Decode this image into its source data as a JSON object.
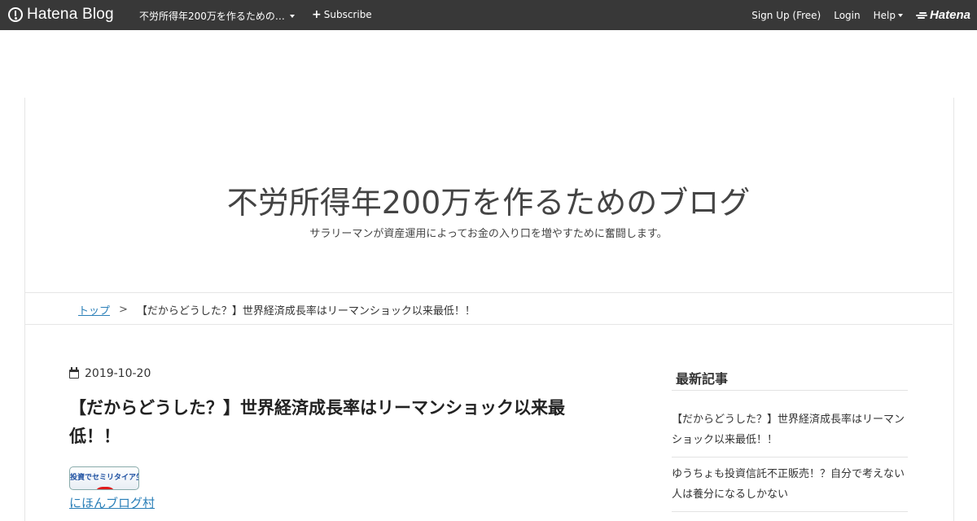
{
  "topbar": {
    "logo_text": "Hatena Blog",
    "blog_selector": "不労所得年200万を作るための…",
    "subscribe": "Subscribe",
    "sign_up": "Sign Up (Free)",
    "login": "Login",
    "help": "Help",
    "hatena": "Hatena"
  },
  "header": {
    "title": "不労所得年200万を作るためのブログ",
    "description": "サラリーマンが資産運用によってお金の入り口を増やすために奮闘します。"
  },
  "breadcrumb": {
    "top": "トップ",
    "separator": ">",
    "current": "【だからどうした？】世界経済成長率はリーマンショック以来最低！！"
  },
  "article": {
    "date": "2019-10-20",
    "title": "【だからどうした？】世界経済成長率はリーマンショック以来最低！！",
    "banner_text": "投資でセミリタイア生活",
    "village_link": "にほんブログ村"
  },
  "sidebar": {
    "heading": "最新記事",
    "items": [
      {
        "title": "【だからどうした？】世界経済成長率はリーマンショック以来最低！！"
      },
      {
        "title": "ゆうちょも投資信託不正販売！？自分で考えない人は養分になるしかない"
      }
    ]
  },
  "colors": {
    "topbar_bg": "#383838",
    "link": "#2a7fb8"
  }
}
